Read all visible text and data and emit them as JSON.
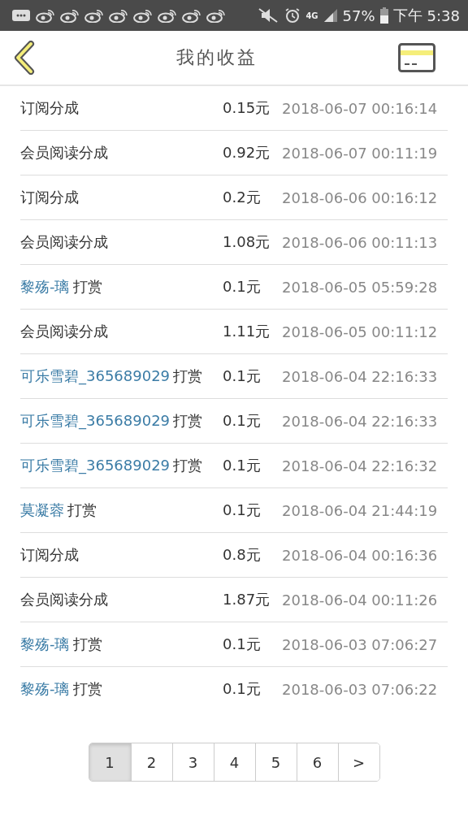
{
  "status_bar": {
    "notifications": [
      {
        "kind": "message"
      },
      {
        "kind": "app"
      },
      {
        "kind": "app"
      },
      {
        "kind": "app"
      },
      {
        "kind": "app"
      },
      {
        "kind": "app"
      },
      {
        "kind": "app"
      },
      {
        "kind": "app"
      },
      {
        "kind": "app"
      }
    ],
    "network": "4G",
    "battery": "57%",
    "period": "下午",
    "time": "5:38"
  },
  "header": {
    "title": "我的收益"
  },
  "rows": [
    {
      "kind": "income",
      "label": "订阅分成",
      "amount": "0.15元",
      "time": "2018-06-07 00:16:14"
    },
    {
      "kind": "income",
      "label": "会员阅读分成",
      "amount": "0.92元",
      "time": "2018-06-07 00:11:19"
    },
    {
      "kind": "income",
      "label": "订阅分成",
      "amount": "0.2元",
      "time": "2018-06-06 00:16:12"
    },
    {
      "kind": "income",
      "label": "会员阅读分成",
      "amount": "1.08元",
      "time": "2018-06-06 00:11:13"
    },
    {
      "kind": "reward",
      "user": "黎殇-璃",
      "action": "打赏",
      "amount": "0.1元",
      "time": "2018-06-05 05:59:28"
    },
    {
      "kind": "income",
      "label": "会员阅读分成",
      "amount": "1.11元",
      "time": "2018-06-05 00:11:12"
    },
    {
      "kind": "reward",
      "user": "可乐雪碧_365689029",
      "action": "打赏",
      "amount": "0.1元",
      "time": "2018-06-04 22:16:33"
    },
    {
      "kind": "reward",
      "user": "可乐雪碧_365689029",
      "action": "打赏",
      "amount": "0.1元",
      "time": "2018-06-04 22:16:33"
    },
    {
      "kind": "reward",
      "user": "可乐雪碧_365689029",
      "action": "打赏",
      "amount": "0.1元",
      "time": "2018-06-04 22:16:32"
    },
    {
      "kind": "reward",
      "user": "莫凝蓉",
      "action": "打赏",
      "amount": "0.1元",
      "time": "2018-06-04 21:44:19"
    },
    {
      "kind": "income",
      "label": "订阅分成",
      "amount": "0.8元",
      "time": "2018-06-04 00:16:36"
    },
    {
      "kind": "income",
      "label": "会员阅读分成",
      "amount": "1.87元",
      "time": "2018-06-04 00:11:26"
    },
    {
      "kind": "reward",
      "user": "黎殇-璃",
      "action": "打赏",
      "amount": "0.1元",
      "time": "2018-06-03 07:06:27"
    },
    {
      "kind": "reward",
      "user": "黎殇-璃",
      "action": "打赏",
      "amount": "0.1元",
      "time": "2018-06-03 07:06:22"
    }
  ],
  "pagination": [
    {
      "label": "1",
      "selected": true
    },
    {
      "label": "2",
      "selected": false
    },
    {
      "label": "3",
      "selected": false
    },
    {
      "label": "4",
      "selected": false
    },
    {
      "label": "5",
      "selected": false
    },
    {
      "label": "6",
      "selected": false
    },
    {
      "label": ">",
      "selected": false
    }
  ]
}
